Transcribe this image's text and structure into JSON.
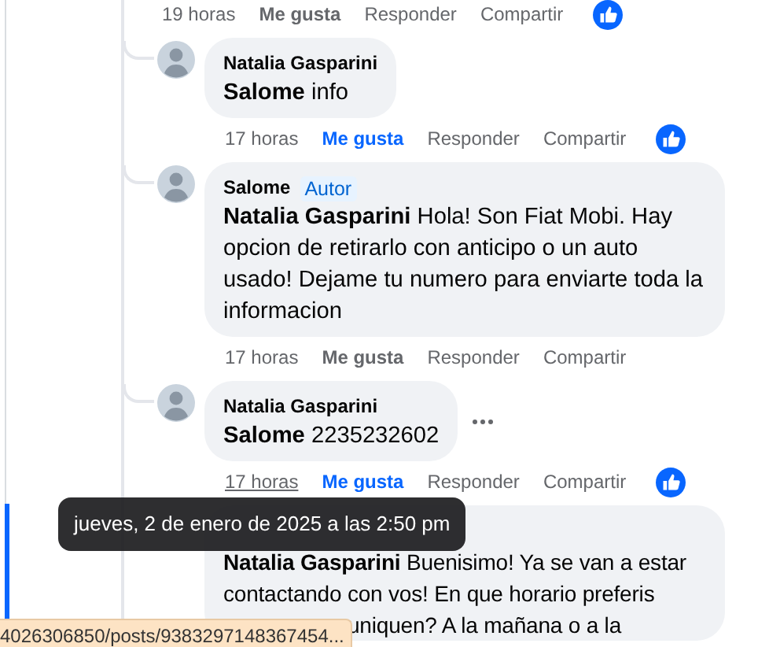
{
  "top_actions": {
    "time": "19 horas",
    "like": "Me gusta",
    "reply": "Responder",
    "share": "Compartir",
    "liked": false,
    "reaction": true
  },
  "comments": [
    {
      "author": "Natalia Gasparini",
      "mention": "Salome",
      "text": "info",
      "actions": {
        "time": "17 horas",
        "like": "Me gusta",
        "reply": "Responder",
        "share": "Compartir",
        "liked": true,
        "reaction": true,
        "time_hovered": false
      },
      "show_more": false
    },
    {
      "author": "Salome",
      "badge": "Autor",
      "mention": "Natalia Gasparini",
      "text": "Hola! Son Fiat Mobi. Hay opcion de retirarlo con anticipo o un auto usado! Dejame tu numero para enviarte toda la informacion",
      "actions": {
        "time": "17 horas",
        "like": "Me gusta",
        "reply": "Responder",
        "share": "Compartir",
        "liked": false,
        "reaction": false,
        "time_hovered": false
      },
      "show_more": false
    },
    {
      "author": "Natalia Gasparini",
      "mention": "Salome",
      "text": "2235232602",
      "actions": {
        "time": "17 horas",
        "like": "Me gusta",
        "reply": "Responder",
        "share": "Compartir",
        "liked": true,
        "reaction": true,
        "time_hovered": true
      },
      "show_more": true
    },
    {
      "mention": "Natalia Gasparini",
      "text": "Buenisimo! Ya se van a estar contactando con vos! En que horario preferis",
      "text_continued": "uniquen? A la mañana o a la",
      "show_more": false
    }
  ],
  "tooltip": {
    "text": "jueves, 2 de enero de 2025 a las 2:50 pm"
  },
  "status_bar": {
    "url": "4026306850/posts/9383297148367454..."
  }
}
